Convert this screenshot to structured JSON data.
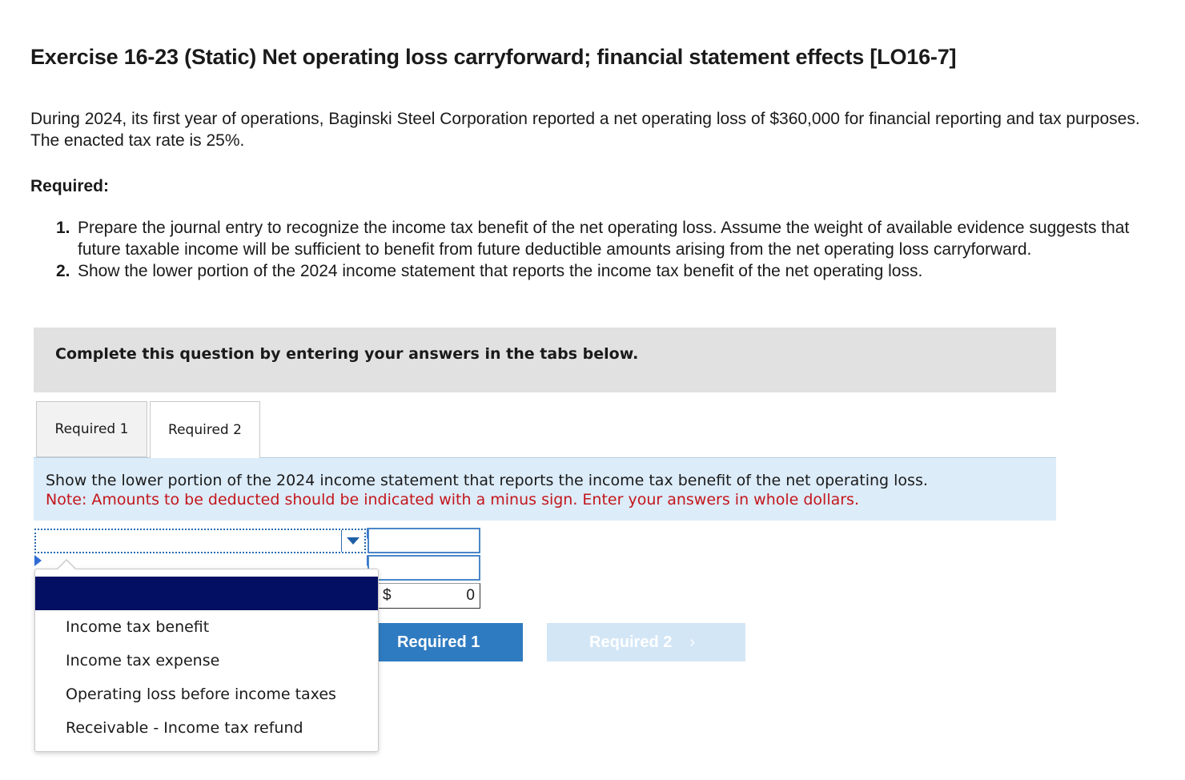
{
  "exercise": {
    "title": "Exercise 16-23 (Static) Net operating loss carryforward; financial statement effects [LO16-7]",
    "intro": "During 2024, its first year of operations, Baginski Steel Corporation reported a net operating loss of $360,000 for financial reporting and tax purposes. The enacted tax rate is 25%.",
    "required_heading": "Required:",
    "requirements": [
      {
        "num": "1.",
        "text": "Prepare the journal entry to recognize the income tax benefit of the net operating loss. Assume the weight of available evidence suggests that future taxable income will be sufficient to benefit from future deductible amounts arising from the net operating loss carryforward."
      },
      {
        "num": "2.",
        "text": "Show the lower portion of the 2024 income statement that reports the income tax benefit of the net operating loss."
      }
    ]
  },
  "complete_box": {
    "text": "Complete this question by entering your answers in the tabs below."
  },
  "tabs": [
    {
      "label": "Required 1",
      "active": false
    },
    {
      "label": "Required 2",
      "active": true
    }
  ],
  "instructions": {
    "text": "Show the lower portion of the 2024 income statement that reports the income tax benefit of the net operating loss.",
    "note": "Note: Amounts to be deducted should be indicated with a minus sign. Enter your answers in whole dollars."
  },
  "answer_table": {
    "rows": [
      {
        "label": "",
        "amount": ""
      },
      {
        "label": "",
        "amount": ""
      },
      {
        "label": "",
        "currency": "$",
        "amount": "0"
      }
    ]
  },
  "dropdown": {
    "selected": "",
    "options": [
      "",
      "Income tax benefit",
      "Income tax expense",
      "Operating loss before income taxes",
      "Receivable - Income tax refund"
    ],
    "highlight_color": "#020f62"
  },
  "navigation": {
    "prev_label": "Required 1",
    "next_label": "Required 2",
    "next_chevron": "›"
  },
  "colors": {
    "note_red": "#c4161c",
    "primary_blue": "#2f7bc1",
    "disabled_blue": "#d3e6f6",
    "instruction_bg": "#dcecf9"
  }
}
